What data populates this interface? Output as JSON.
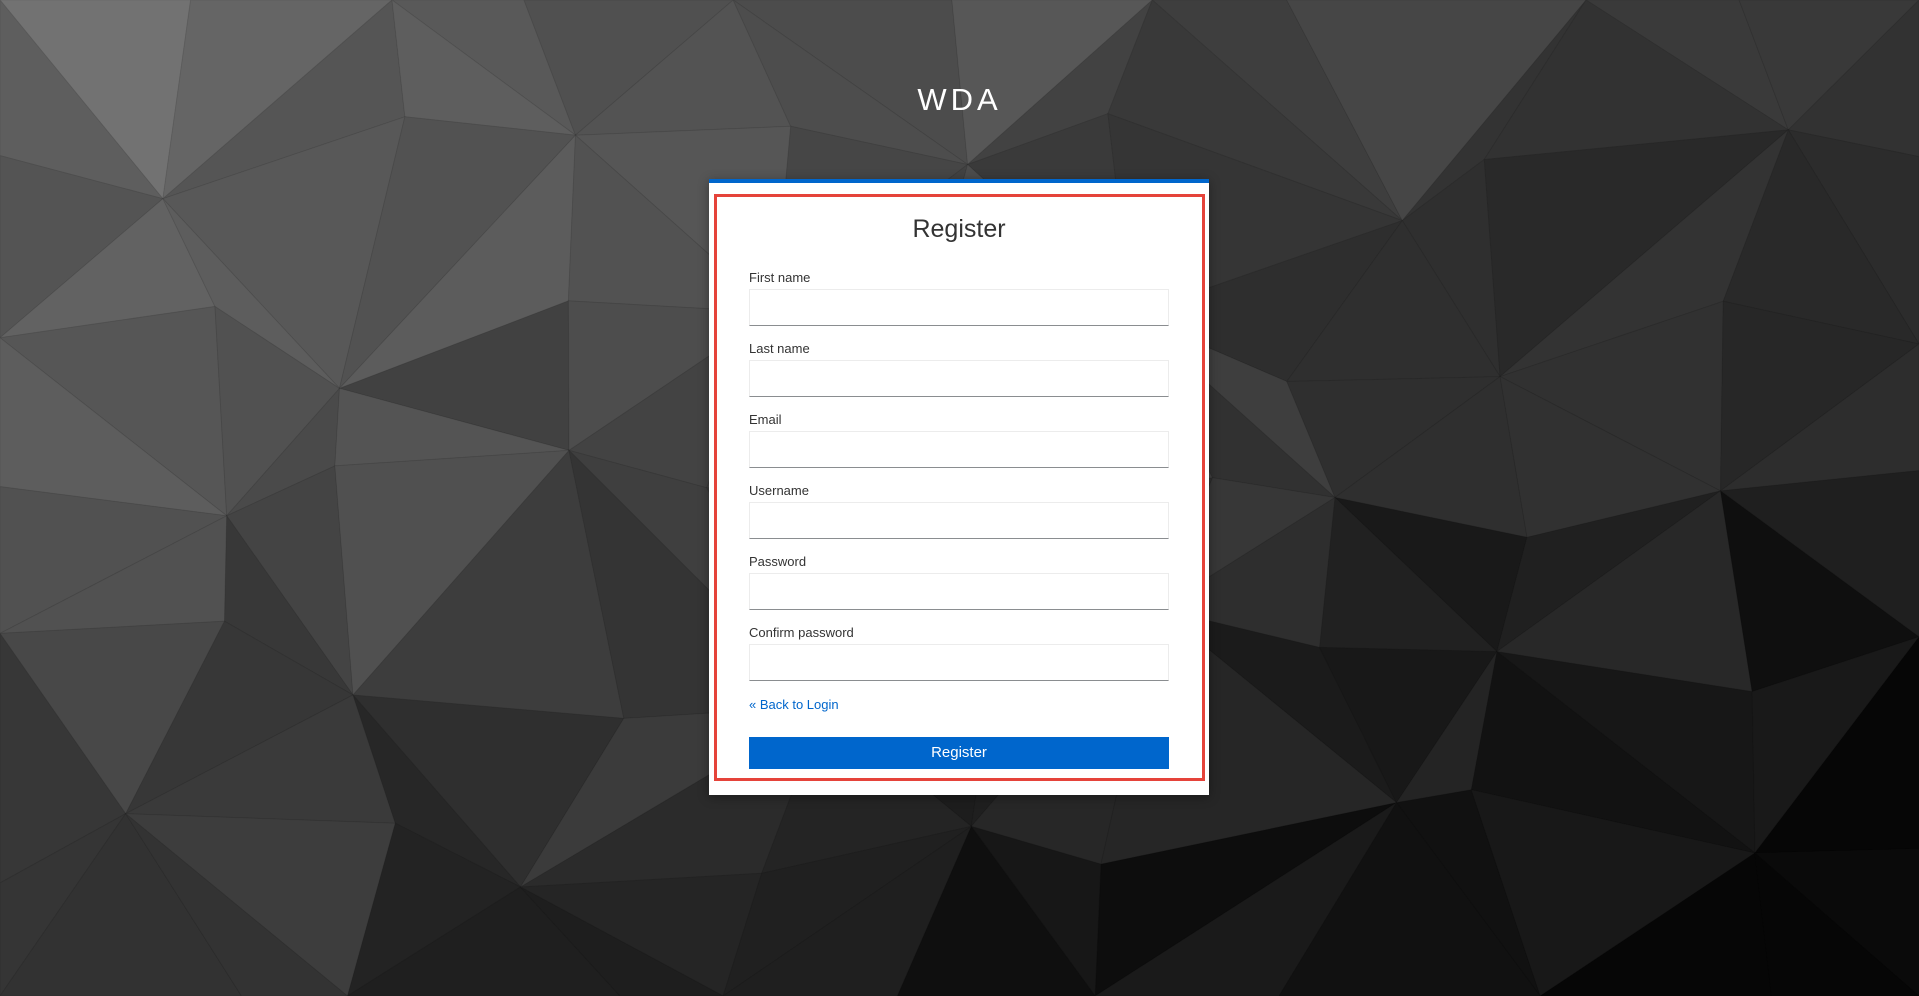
{
  "page": {
    "realm_title": "WDA",
    "background_color": "#3a3a3a"
  },
  "form": {
    "title": "Register",
    "accent_color": "#0066cc",
    "highlight_color": "#e5433a",
    "fields": [
      {
        "label": "First name",
        "value": "",
        "placeholder": ""
      },
      {
        "label": "Last name",
        "value": "",
        "placeholder": ""
      },
      {
        "label": "Email",
        "value": "",
        "placeholder": ""
      },
      {
        "label": "Username",
        "value": "",
        "placeholder": ""
      },
      {
        "label": "Password",
        "value": "",
        "placeholder": ""
      },
      {
        "label": "Confirm password",
        "value": "",
        "placeholder": ""
      }
    ],
    "back_link": "« Back to Login",
    "submit_label": "Register"
  }
}
